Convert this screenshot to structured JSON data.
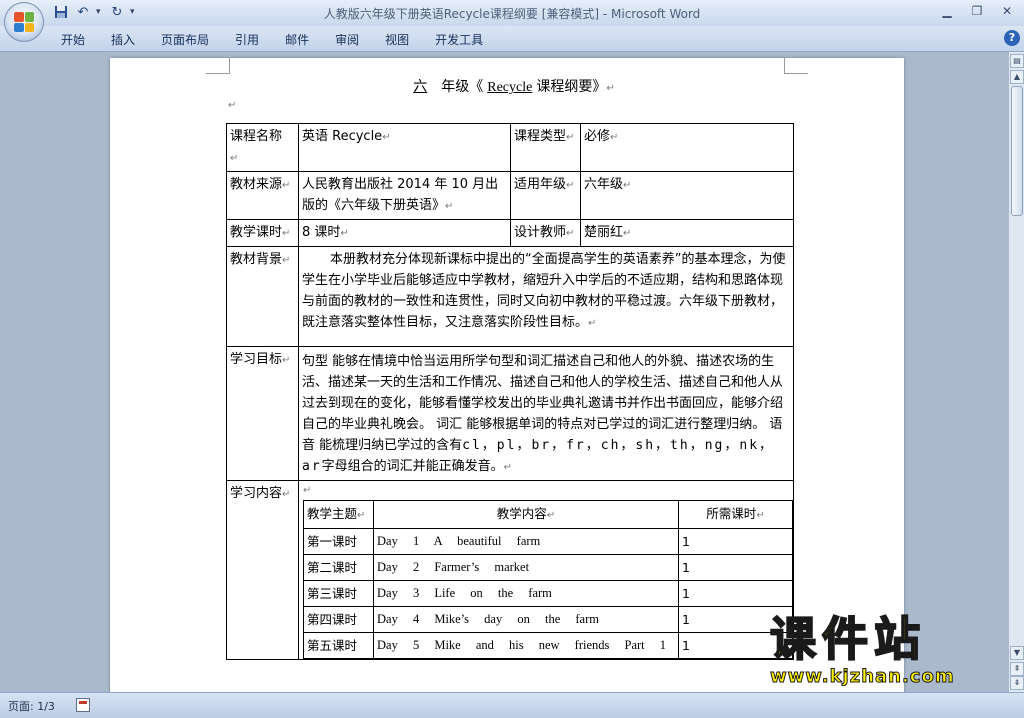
{
  "window": {
    "title": "人教版六年级下册英语Recycle课程纲要 [兼容模式] - Microsoft Word",
    "controls": [
      "minimize",
      "restore",
      "close"
    ]
  },
  "quick_access": {
    "items": [
      "save-icon",
      "undo-icon",
      "redo-icon",
      "customize-icon"
    ]
  },
  "ribbon": {
    "tabs": [
      "开始",
      "插入",
      "页面布局",
      "引用",
      "邮件",
      "审阅",
      "视图",
      "开发工具"
    ]
  },
  "document": {
    "title_grade": "六",
    "title_mid": "年级《",
    "title_course": "Recycle",
    "title_end": "课程纲要》",
    "rows": {
      "course_name_label": "课程名称",
      "course_name_value": "英语     Recycle",
      "course_type_label": "课程类型",
      "course_type_value": "必修",
      "source_label": "教材来源",
      "source_value": "人民教育出版社 2014 年 10 月出版的《六年级下册英语》",
      "grade_label": "适用年级",
      "grade_value": "六年级",
      "hours_label": "教学课时",
      "hours_value": "8 课时",
      "designer_label": "设计教师",
      "designer_value": "楚丽红",
      "background_label": "教材背景",
      "background_value": "本册教材充分体现新课标中提出的“全面提高学生的英语素养”的基本理念，为使学生在小学毕业后能够适应中学教材，缩短升入中学后的不适应期，结构和思路体现与前面的教材的一致性和连贯性，同时又向初中教材的平稳过渡。六年级下册教材，既注意落实整体性目标，又注意落实阶段性目标。",
      "goals_label": "学习目标",
      "goals_value_1": "句型     能够在情境中恰当运用所学句型和词汇描述自己和他人的外貌、描述农场的生活、描述某一天的生活和工作情况、描述自己和他人的学校生活、描述自己和他人从过去到现在的变化，能够看懂学校发出的毕业典礼邀请书并作出书面回应，能够介绍自己的毕业典礼晚会。   词汇      能够根据单词的特点对已学过的词汇进行整理归纳。      语音      能梳理归纳已学过的含有",
      "goals_value_latin": "cl，pl，br，fr，ch，sh，th，ng，nk，ar",
      "goals_value_2": "字母组合的词汇并能正确发音。",
      "content_label": "学习内容"
    },
    "schedule": {
      "headers": [
        "教学主题",
        "教学内容",
        "所需课时"
      ],
      "rows": [
        {
          "topic": "第一课时",
          "content": "Day 1 A beautiful farm",
          "hours": "1"
        },
        {
          "topic": "第二课时",
          "content": "Day 2 Farmer’s market",
          "hours": "1"
        },
        {
          "topic": "第三课时",
          "content": "Day 3 Life on the farm",
          "hours": "1"
        },
        {
          "topic": "第四课时",
          "content": "Day 4 Mike’s day on the farm",
          "hours": "1"
        },
        {
          "topic": "第五课时",
          "content": "Day 5 Mike and his new friends Part 1",
          "hours": "1"
        }
      ]
    }
  },
  "statusbar": {
    "page_info": "页面: 1/3"
  },
  "watermark": {
    "big": "课件站",
    "small": "www.kjzhan.com"
  },
  "colors": {
    "ribbon": "#c3d3ea",
    "workspace": "#abb9cc",
    "watermark": "#fff200"
  }
}
